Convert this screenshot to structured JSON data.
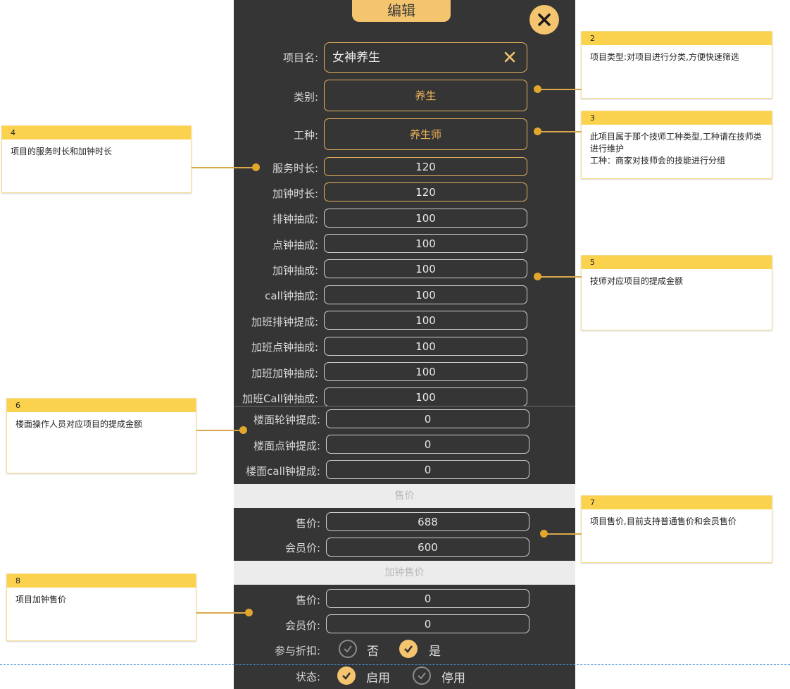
{
  "dialog": {
    "title": "编辑",
    "name_label": "项目名:",
    "name_value": "女神养生",
    "category_label": "类别:",
    "category_value": "养生",
    "worktype_label": "工种:",
    "worktype_value": "养生师"
  },
  "duration": {
    "service_label": "服务时长:",
    "service_value": "120",
    "extra_label": "加钟时长:",
    "extra_value": "120"
  },
  "commission": [
    {
      "label": "排钟抽成:",
      "value": "100"
    },
    {
      "label": "点钟抽成:",
      "value": "100"
    },
    {
      "label": "加钟抽成:",
      "value": "100"
    },
    {
      "label": "call钟抽成:",
      "value": "100"
    },
    {
      "label": "加班排钟提成:",
      "value": "100"
    },
    {
      "label": "加班点钟抽成:",
      "value": "100"
    },
    {
      "label": "加班加钟抽成:",
      "value": "100"
    },
    {
      "label": "加班Call钟抽成:",
      "value": "100"
    }
  ],
  "floor": [
    {
      "label": "楼面轮钟提成:",
      "value": "0"
    },
    {
      "label": "楼面点钟提成:",
      "value": "0"
    },
    {
      "label": "楼面call钟提成:",
      "value": "0"
    }
  ],
  "price_section": {
    "title": "售价",
    "price_label": "售价:",
    "price_value": "688",
    "member_label": "会员价:",
    "member_value": "600"
  },
  "extra_price_section": {
    "title": "加钟售价",
    "price_label": "售价:",
    "price_value": "0",
    "member_label": "会员价:",
    "member_value": "0"
  },
  "discount": {
    "label": "参与折扣:",
    "no": "否",
    "yes": "是",
    "selected": "是"
  },
  "status": {
    "label": "状态:",
    "enabled": "启用",
    "disabled": "停用",
    "selected": "启用"
  },
  "callouts": [
    {
      "num": "2",
      "text": "项目类型:对项目进行分类,方便快速筛选"
    },
    {
      "num": "3",
      "text": "此项目属于那个技师工种类型,工种请在技师类进行维护\n工种：商家对技师会的技能进行分组"
    },
    {
      "num": "4",
      "text": "项目的服务时长和加钟时长"
    },
    {
      "num": "5",
      "text": "技师对应项目的提成金额"
    },
    {
      "num": "6",
      "text": "楼面操作人员对应项目的提成金额"
    },
    {
      "num": "7",
      "text": "项目售价,目前支持普通售价和会员售价"
    },
    {
      "num": "8",
      "text": "项目加钟售价"
    }
  ],
  "colors": {
    "accent": "#f4c46e",
    "panel": "#353535",
    "callout_header": "#fbd24e"
  }
}
